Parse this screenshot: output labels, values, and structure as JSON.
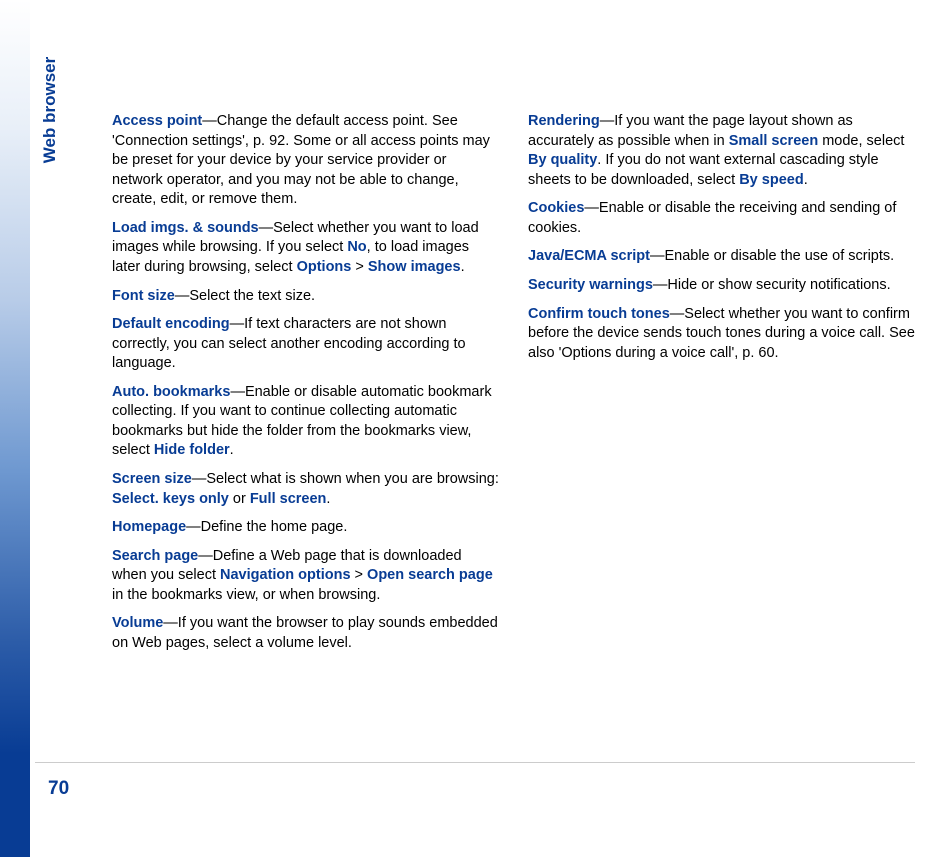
{
  "sidebar": {
    "section_title": "Web browser",
    "page_number": "70"
  },
  "col1": {
    "p1": {
      "term": "Access point",
      "text": "—Change the default access point. See 'Connection settings', p. 92. Some or all access points may be preset for your device by your service provider or network operator, and you may not be able to change, create, edit, or remove them."
    },
    "p2": {
      "term": "Load imgs. & sounds",
      "text1": "—Select whether you want to load images while browsing. If you select ",
      "opt1": "No",
      "text2": ", to load images later during browsing, select ",
      "opt2": "Options",
      "sep": " > ",
      "opt3": "Show images",
      "text3": "."
    },
    "p3": {
      "term": "Font size",
      "text": "—Select the text size."
    },
    "p4": {
      "term": "Default encoding",
      "text": "—If text characters are not shown correctly, you can select another encoding according to language."
    },
    "p5": {
      "term": "Auto. bookmarks",
      "text1": "—Enable or disable automatic bookmark collecting. If you want to continue collecting automatic bookmarks but hide the folder from the bookmarks view, select ",
      "opt1": "Hide folder",
      "text2": "."
    },
    "p6": {
      "term": "Screen size",
      "text1": "—Select what is shown when you are browsing: ",
      "opt1": "Select. keys only",
      "text2": " or ",
      "opt2": "Full screen",
      "text3": "."
    },
    "p7": {
      "term": "Homepage",
      "text": "—Define the home page."
    },
    "p8": {
      "term": "Search page",
      "text1": "—Define a Web page that is downloaded when you select ",
      "opt1": "Navigation options",
      "sep": " > ",
      "opt2": "Open search page",
      "text2": " in the bookmarks view, or when browsing."
    },
    "p9": {
      "term": "Volume",
      "text": "—If you want the browser to play sounds embedded on Web pages, select a volume level."
    }
  },
  "col2": {
    "p1": {
      "term": "Rendering",
      "text1": "—If you want the page layout shown as accurately as possible when in ",
      "opt1": "Small screen",
      "text2": " mode, select ",
      "opt2": "By quality",
      "text3": ". If you do not want external cascading style sheets to be downloaded, select ",
      "opt3": "By speed",
      "text4": "."
    },
    "p2": {
      "term": "Cookies",
      "text": "—Enable or disable the receiving and sending of cookies."
    },
    "p3": {
      "term": "Java/ECMA script",
      "text": "—Enable or disable the use of scripts."
    },
    "p4": {
      "term": "Security warnings",
      "text": "—Hide or show security notifications."
    },
    "p5": {
      "term": "Confirm touch tones",
      "text": "—Select whether you want to confirm before the device sends touch tones during a voice call. See also 'Options during a voice call', p. 60."
    }
  }
}
